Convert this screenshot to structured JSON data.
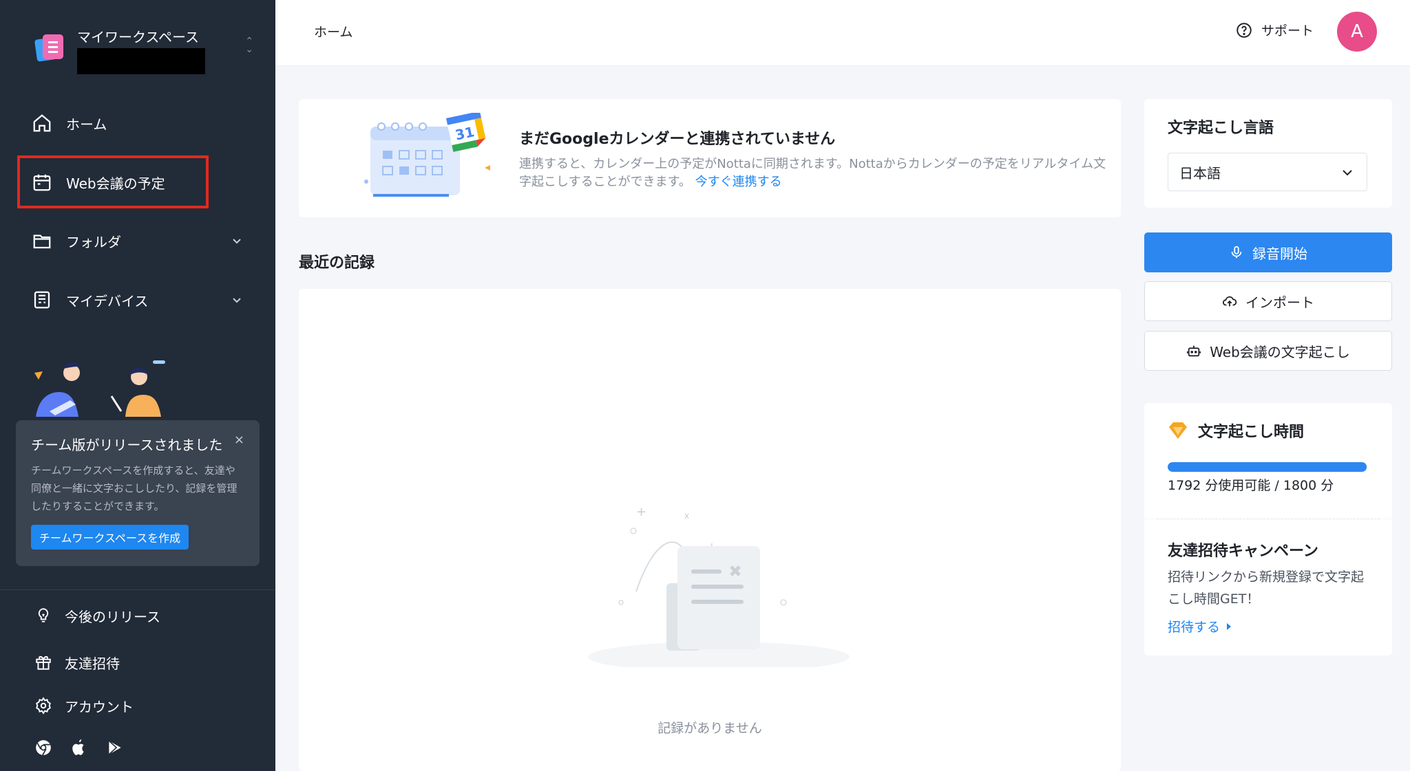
{
  "workspace": {
    "name": "マイワークスペース"
  },
  "nav": {
    "home": "ホーム",
    "web_meetings": "Web会議の予定",
    "folder": "フォルダ",
    "devices": "マイデバイス"
  },
  "promo": {
    "title": "チーム版がリリースされました",
    "close": "×",
    "desc": "チームワークスペースを作成すると、友達や同僚と一緒に文字おこししたり、記録を管理したりすることができます。",
    "button": "チームワークスペースを作成"
  },
  "bottom_links": {
    "releases": "今後のリリース",
    "invite": "友達招待",
    "account": "アカウント"
  },
  "topbar": {
    "breadcrumb": "ホーム",
    "support": "サポート",
    "avatar": "A"
  },
  "banner": {
    "calendar_day": "31",
    "title": "まだGoogleカレンダーと連携されていません",
    "desc": "連携すると、カレンダー上の予定がNottaに同期されます。Nottaからカレンダーの予定をリアルタイム文字起こしすることができます。",
    "link": "今すぐ連携する"
  },
  "records": {
    "title": "最近の記録",
    "empty": "記録がありません"
  },
  "language": {
    "title": "文字起こし言語",
    "selected": "日本語"
  },
  "actions": {
    "record": "録音開始",
    "import": "インポート",
    "web_transcribe": "Web会議の文字起こし"
  },
  "time": {
    "title": "文字起こし時間",
    "text": "1792 分使用可能 / 1800 分",
    "progress": 0.9956
  },
  "invite_campaign": {
    "title": "友達招待キャンペーン",
    "desc": "招待リンクから新規登録で文字起こし時間GET！",
    "link": "招待する"
  },
  "colors": {
    "sidebar": "#222b38",
    "accent": "#2c87f0",
    "highlight": "#e02a1e",
    "avatar": "#e84c89"
  }
}
